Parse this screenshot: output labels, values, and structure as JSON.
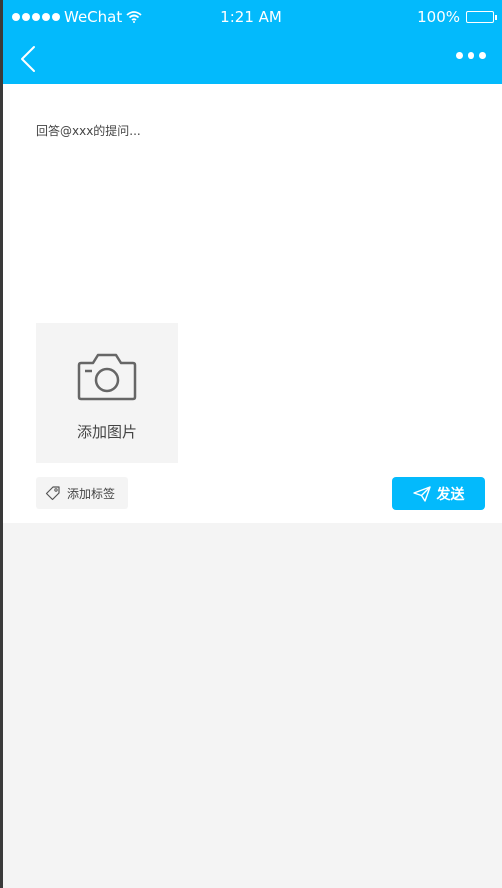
{
  "status_bar": {
    "carrier": "WeChat",
    "time": "1:21 AM",
    "battery": "100%"
  },
  "nav": {
    "back_icon": "chevron-left-icon",
    "more_icon": "more-horizontal-icon"
  },
  "compose": {
    "placeholder": "回答@xxx的提问...",
    "add_image_label": "添加图片",
    "add_tag_label": "添加标签",
    "send_label": "发送"
  },
  "colors": {
    "accent": "#03bafc",
    "background": "#f4f4f4",
    "panel": "#ffffff"
  }
}
